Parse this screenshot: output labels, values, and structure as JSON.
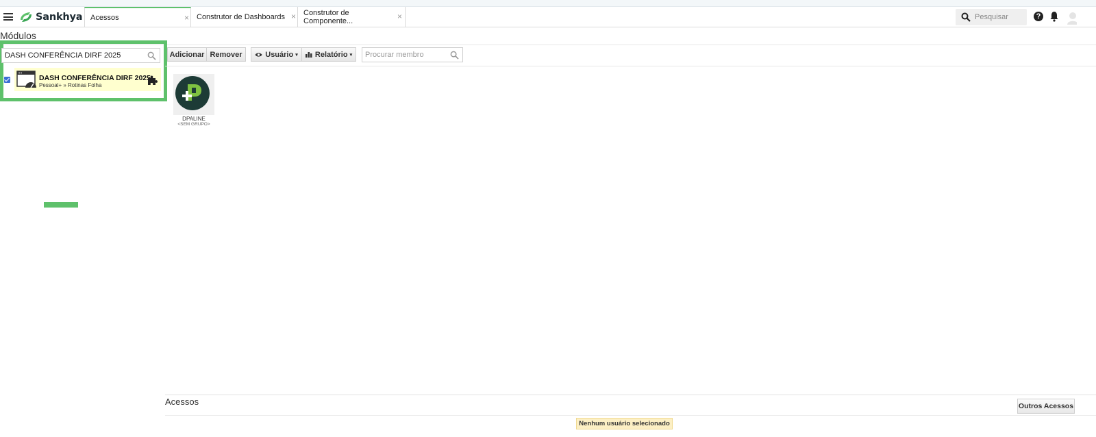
{
  "header": {
    "brand": "Sankhya",
    "tabs": [
      {
        "label": "Acessos"
      },
      {
        "label": "Construtor de Dashboards"
      },
      {
        "label": "Construtor de Componente..."
      }
    ],
    "close_glyph": "×",
    "search_placeholder": "Pesquisar",
    "help_glyph": "?",
    "brand_color": "#5ec16b"
  },
  "page": {
    "title": "Módulos"
  },
  "module_panel": {
    "search_value": "DASH CONFERÊNCIA DIRF 2025",
    "items": [
      {
        "name": "DASH CONFERÊNCIA DIRF 2025",
        "path": "Pessoal+ » Rotinas Folha",
        "checked": true,
        "icon": "dashboard-gauge-icon",
        "badge_icon": "puzzle-icon"
      }
    ]
  },
  "toolbar": {
    "add_label": "Adicionar",
    "remove_label": "Remover",
    "user_label": "Usuário",
    "report_label": "Relatório",
    "caret": "▾",
    "member_search_placeholder": "Procurar membro"
  },
  "members": [
    {
      "name": "DPALINE",
      "group": "<SEM GRUPO>"
    }
  ],
  "access_section": {
    "title": "Acessos",
    "other_access_label": "Outros Acessos",
    "empty_message": "Nenhum usuário selecionado"
  }
}
